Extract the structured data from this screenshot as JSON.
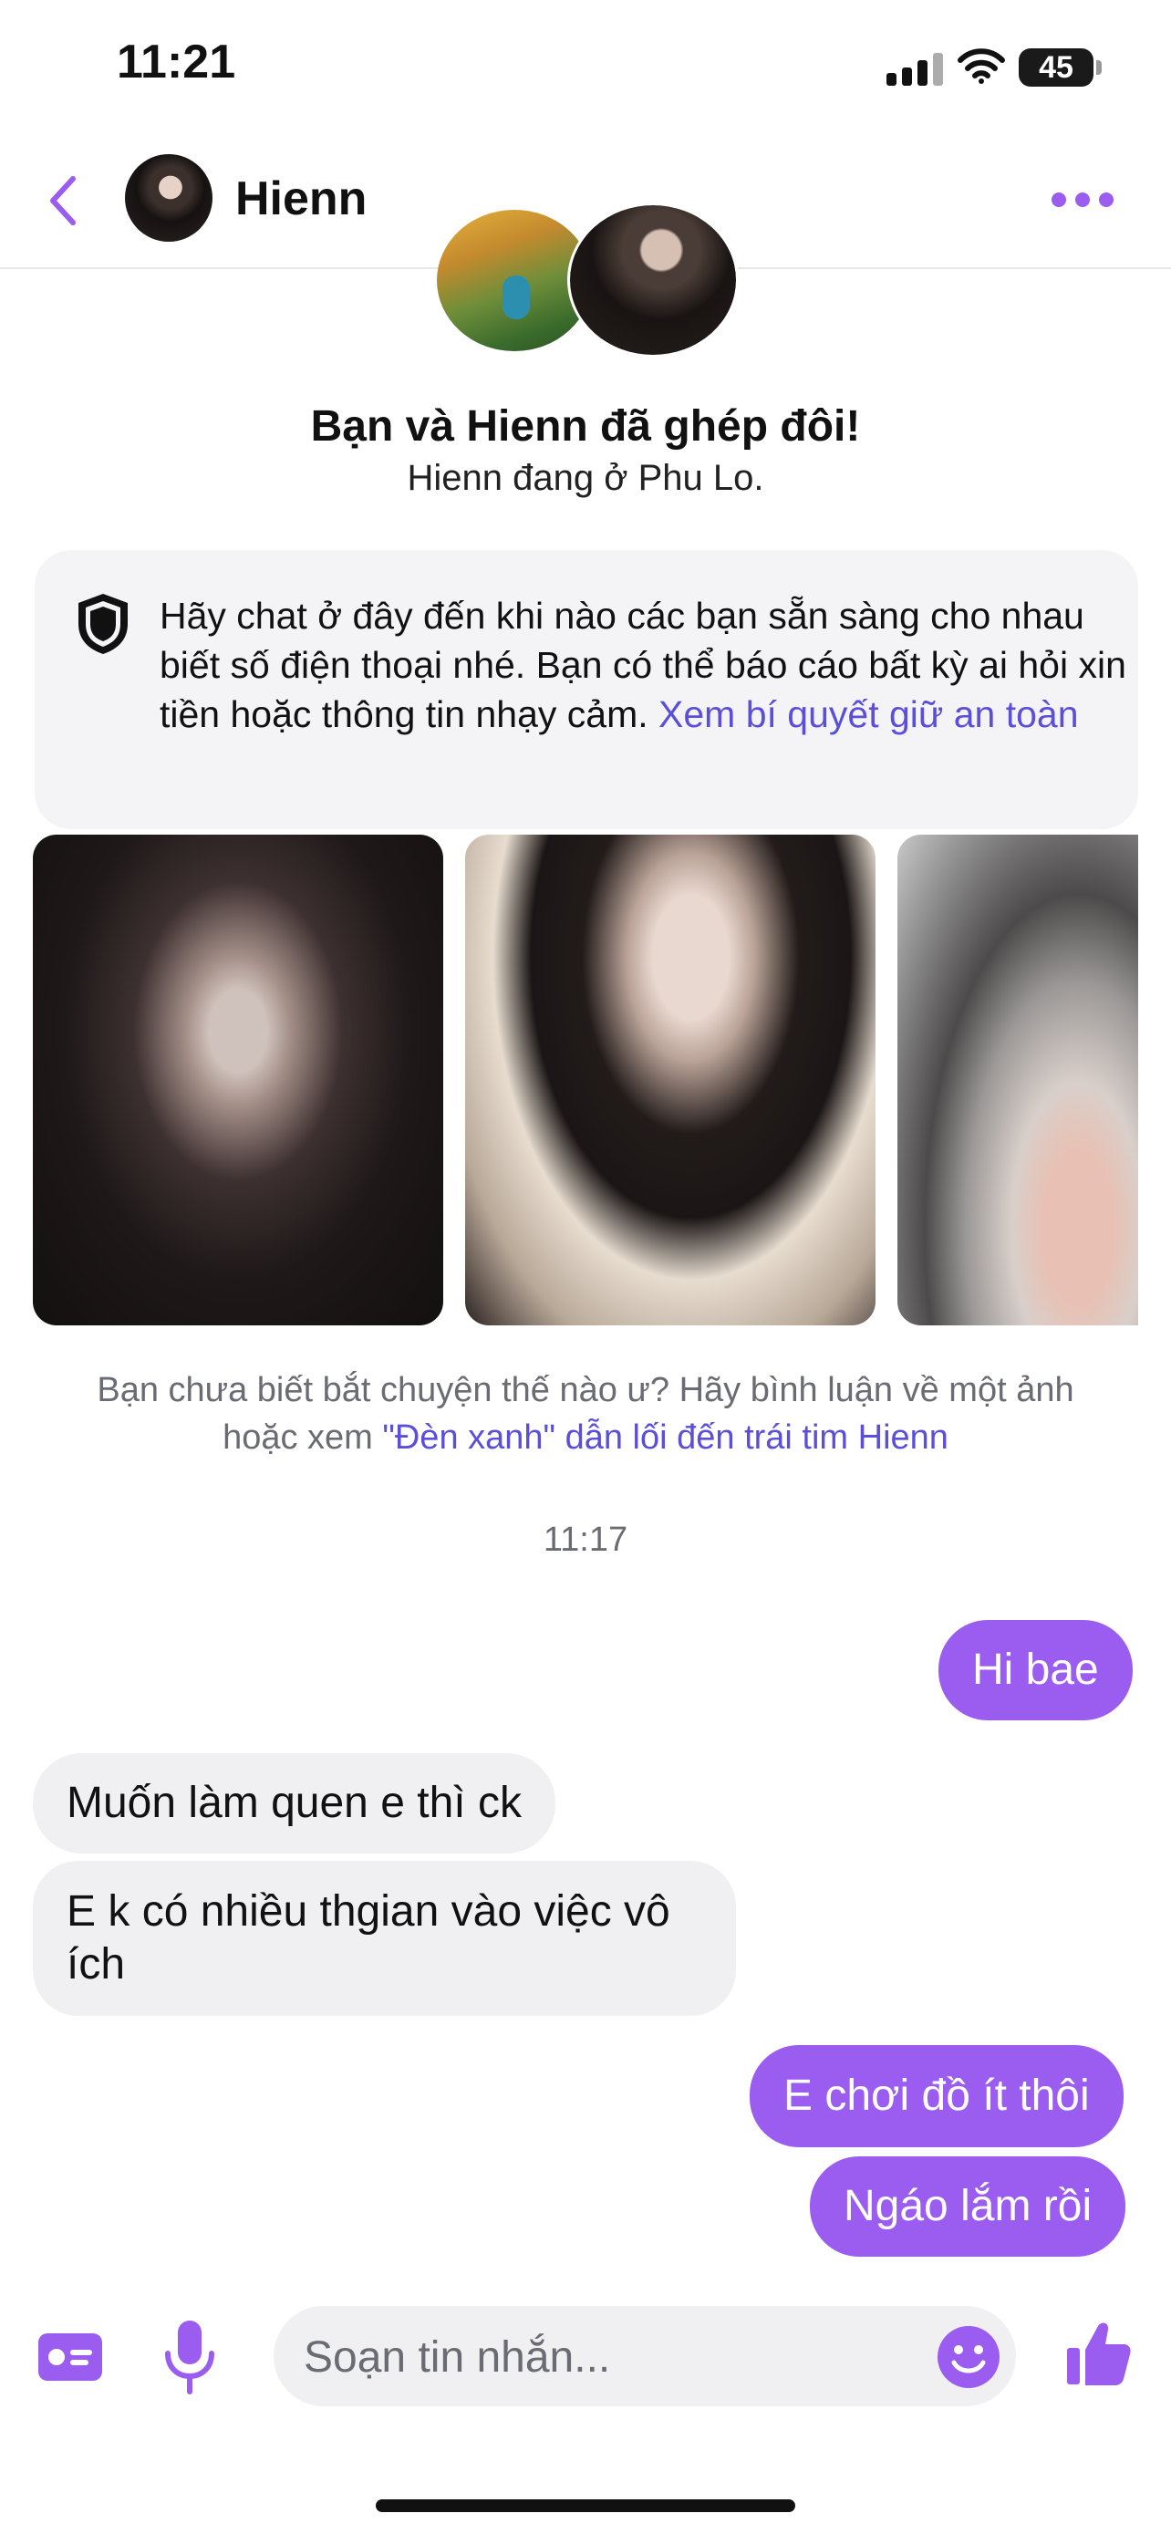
{
  "status_bar": {
    "time": "11:21",
    "battery": "45"
  },
  "header": {
    "name": "Hienn"
  },
  "match": {
    "title": "Bạn và Hienn đã ghép đôi!",
    "location": "Hienn đang ở Phu Lo."
  },
  "safety": {
    "text": "Hãy chat ở đây đến khi nào các bạn sẵn sàng cho nhau biết số điện thoại nhé. Bạn có thể báo cáo bất kỳ ai hỏi xin tiền hoặc thông tin nhạy cảm.",
    "link": "Xem bí quyết giữ an toàn"
  },
  "starter": {
    "text": "Bạn chưa biết bắt chuyện thế nào ư? Hãy bình luận về một ảnh hoặc xem",
    "link": "\"Đèn xanh\" dẫn lối đến trái tim Hienn"
  },
  "timestamp": "11:17",
  "messages": [
    {
      "side": "sent",
      "text": "Hi bae"
    },
    {
      "side": "received",
      "text": "Muốn làm quen e thì ck"
    },
    {
      "side": "received",
      "text": "E k có nhiều thgian vào việc vô ích"
    },
    {
      "side": "sent",
      "text": "E chơi đồ ít thôi"
    },
    {
      "side": "sent",
      "text": "Ngáo lắm rồi"
    }
  ],
  "composer": {
    "placeholder": "Soạn tin nhắn..."
  },
  "colors": {
    "accent": "#9b5cf0",
    "link": "#5b4fd9",
    "bubble_received": "#f0f0f2"
  }
}
